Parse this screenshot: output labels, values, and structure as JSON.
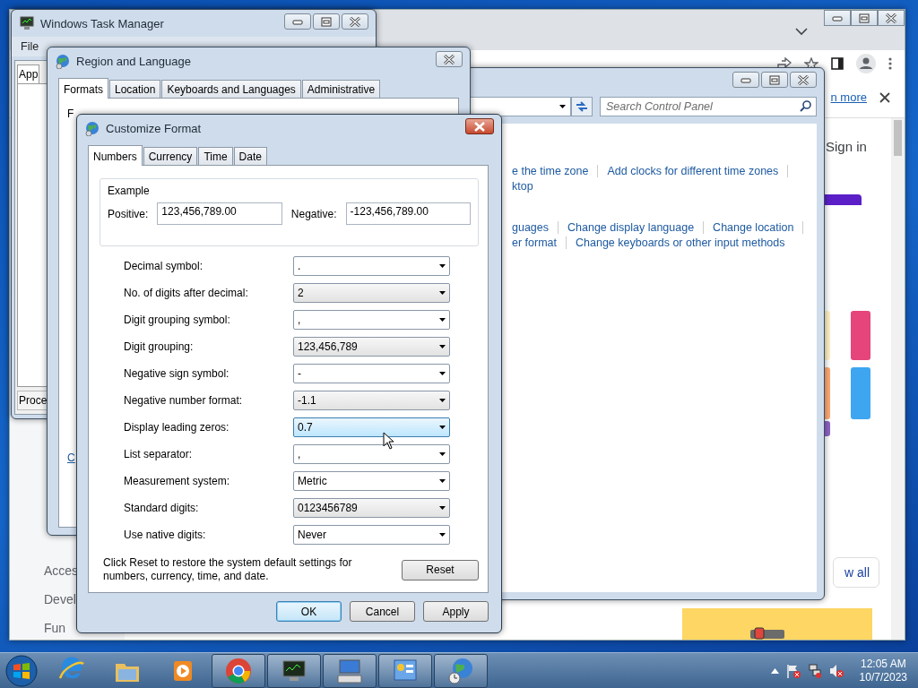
{
  "browser": {
    "infobar_link": "n more",
    "sign_in": "Sign in",
    "view_all": "w all",
    "sidebar_items": [
      "Acces",
      "Devel",
      "Fun"
    ]
  },
  "task_manager": {
    "title": "Windows Task Manager",
    "menu": [
      "File"
    ],
    "tab_top": "App",
    "tab_bottom": "Proce"
  },
  "control_panel": {
    "search": {
      "placeholder": "Search Control Panel"
    },
    "link_rows": [
      {
        "links": [
          "e the time zone",
          "Add clocks for different time zones"
        ],
        "trailing_separator": true
      },
      {
        "links": [
          "ktop"
        ],
        "trailing_separator": false
      },
      {
        "links": [
          "guages",
          "Change display language",
          "Change location"
        ],
        "trailing_separator": true
      },
      {
        "links": [
          "er format",
          "Change keyboards or other input methods"
        ],
        "trailing_separator": false
      }
    ]
  },
  "region_language": {
    "title": "Region and Language",
    "tabs": [
      {
        "label": "Formats",
        "selected": true
      },
      {
        "label": "Location",
        "selected": false
      },
      {
        "label": "Keyboards and Languages",
        "selected": false
      },
      {
        "label": "Administrative",
        "selected": false
      }
    ],
    "fragment_label": "F",
    "fragment_link": "C"
  },
  "customize_format": {
    "title": "Customize Format",
    "tabs": [
      {
        "label": "Numbers",
        "selected": true
      },
      {
        "label": "Currency",
        "selected": false
      },
      {
        "label": "Time",
        "selected": false
      },
      {
        "label": "Date",
        "selected": false
      }
    ],
    "example": {
      "legend": "Example",
      "positive_label": "Positive:",
      "positive": "123,456,789.00",
      "negative_label": "Negative:",
      "negative": "-123,456,789.00"
    },
    "settings": [
      {
        "label": "Decimal symbol:",
        "value": ".",
        "highlighted": false
      },
      {
        "label": "No. of digits after decimal:",
        "value": "2",
        "highlighted": false
      },
      {
        "label": "Digit grouping symbol:",
        "value": ",",
        "highlighted": false
      },
      {
        "label": "Digit grouping:",
        "value": "123,456,789",
        "highlighted": false
      },
      {
        "label": "Negative sign symbol:",
        "value": "-",
        "highlighted": false
      },
      {
        "label": "Negative number format:",
        "value": "-1.1",
        "highlighted": false
      },
      {
        "label": "Display leading zeros:",
        "value": "0.7",
        "highlighted": true
      },
      {
        "label": "List separator:",
        "value": ",",
        "highlighted": false
      },
      {
        "label": "Measurement system:",
        "value": "Metric",
        "highlighted": false
      },
      {
        "label": "Standard digits:",
        "value": "0123456789",
        "highlighted": false
      },
      {
        "label": "Use native digits:",
        "value": "Never",
        "highlighted": false
      }
    ],
    "reset_note": "Click Reset to restore the system default settings for numbers, currency, time, and date.",
    "reset_button": "Reset",
    "buttons": [
      {
        "label": "OK",
        "default": true
      },
      {
        "label": "Cancel",
        "default": false
      },
      {
        "label": "Apply",
        "default": false
      }
    ]
  },
  "taskbar": {
    "apps": [
      {
        "kind": "ie",
        "running": false
      },
      {
        "kind": "folder",
        "running": false
      },
      {
        "kind": "media",
        "running": false
      },
      {
        "kind": "chrome",
        "running": true
      },
      {
        "kind": "taskmgr",
        "running": true
      },
      {
        "kind": "keyboard",
        "running": true
      },
      {
        "kind": "control",
        "running": true
      },
      {
        "kind": "globe",
        "running": true
      }
    ],
    "time": "12:05 AM",
    "date": "10/7/2023"
  }
}
